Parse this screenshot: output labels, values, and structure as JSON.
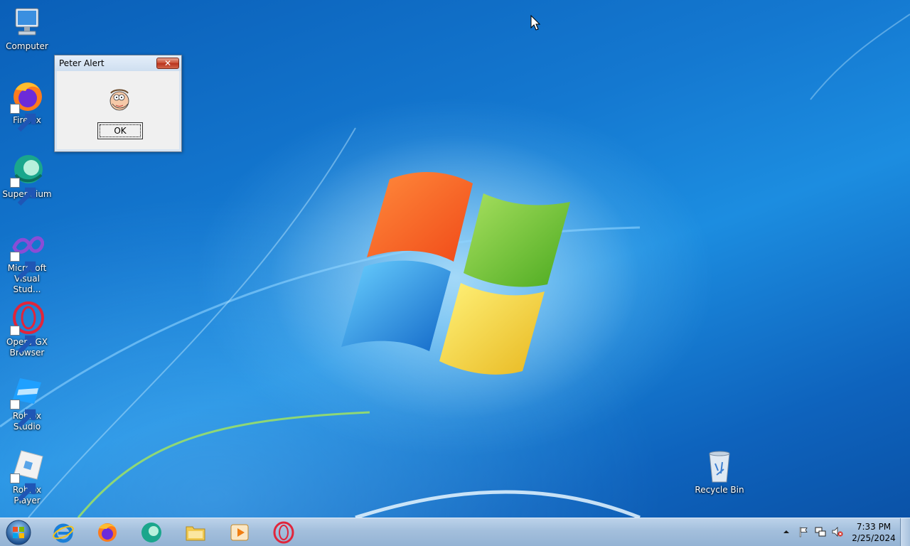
{
  "desktop": {
    "icons": [
      {
        "label": "Computer",
        "icon": "computer-icon"
      },
      {
        "label": "Firefox",
        "icon": "firefox-icon"
      },
      {
        "label": "Supermium",
        "icon": "supermium-icon"
      },
      {
        "label": "Microsoft Visual Stud...",
        "icon": "visual-studio-icon"
      },
      {
        "label": "Opera GX Browser",
        "icon": "opera-gx-icon"
      },
      {
        "label": "Roblox Studio",
        "icon": "roblox-studio-icon"
      },
      {
        "label": "Roblox Player",
        "icon": "roblox-player-icon"
      },
      {
        "label": "Recycle Bin",
        "icon": "recycle-bin-icon"
      }
    ]
  },
  "dialog": {
    "title": "Peter Alert",
    "close_label": "✕",
    "ok_label": "OK",
    "image_icon": "peter-face-icon"
  },
  "taskbar": {
    "pinned": [
      {
        "name": "internet-explorer",
        "icon": "internet-explorer-icon"
      },
      {
        "name": "firefox",
        "icon": "firefox-icon"
      },
      {
        "name": "supermium",
        "icon": "supermium-icon"
      },
      {
        "name": "file-explorer",
        "icon": "folder-icon"
      },
      {
        "name": "media-player",
        "icon": "media-player-icon"
      },
      {
        "name": "opera-gx",
        "icon": "opera-gx-icon"
      }
    ],
    "tray": {
      "icons": [
        "show-hidden-icons-icon",
        "action-center-flag-icon",
        "network-icon",
        "volume-muted-icon"
      ],
      "time": "7:33 PM",
      "date": "2/25/2024"
    }
  },
  "colors": {
    "desktop_blue": "#1478d0",
    "taskbar": "#a3bfdc",
    "close_red": "#c8482d"
  }
}
